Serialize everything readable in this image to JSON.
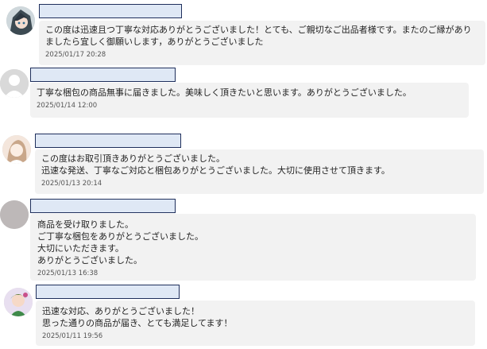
{
  "reviews": [
    {
      "comment": "この度は迅速且つ丁寧な対応ありがとうございました！とても、ご親切なご出品者様です。またのご縁がありましたら宜しく御願いします，ありがとうございました",
      "date": "2025/01/17 20:28",
      "avatar_icon": "anime-avatar-icon"
    },
    {
      "comment": "丁寧な梱包の商品無事に届きました。美味しく頂きたいと思います。ありがとうございました。",
      "date": "2025/01/14 12:00",
      "avatar_icon": "default-user-icon"
    },
    {
      "comment": "この度はお取引頂きありがとうございました。\n迅速な発送、丁寧なご対応と梱包ありがとうございました。大切に使用させて頂きます。",
      "date": "2025/01/13 20:14",
      "avatar_icon": "illustration-avatar-icon"
    },
    {
      "comment": "商品を受け取りました。\nご丁寧な梱包をありがとうございました。\n大切にいただきます。\nありがとうございました。",
      "date": "2025/01/13 16:38",
      "avatar_icon": "gray-circle-avatar-icon"
    },
    {
      "comment": "迅速な対応、ありがとうございました！\n思った通りの商品が届き、とても満足してます！",
      "date": "2025/01/11 19:56",
      "avatar_icon": "character-avatar-icon"
    }
  ]
}
